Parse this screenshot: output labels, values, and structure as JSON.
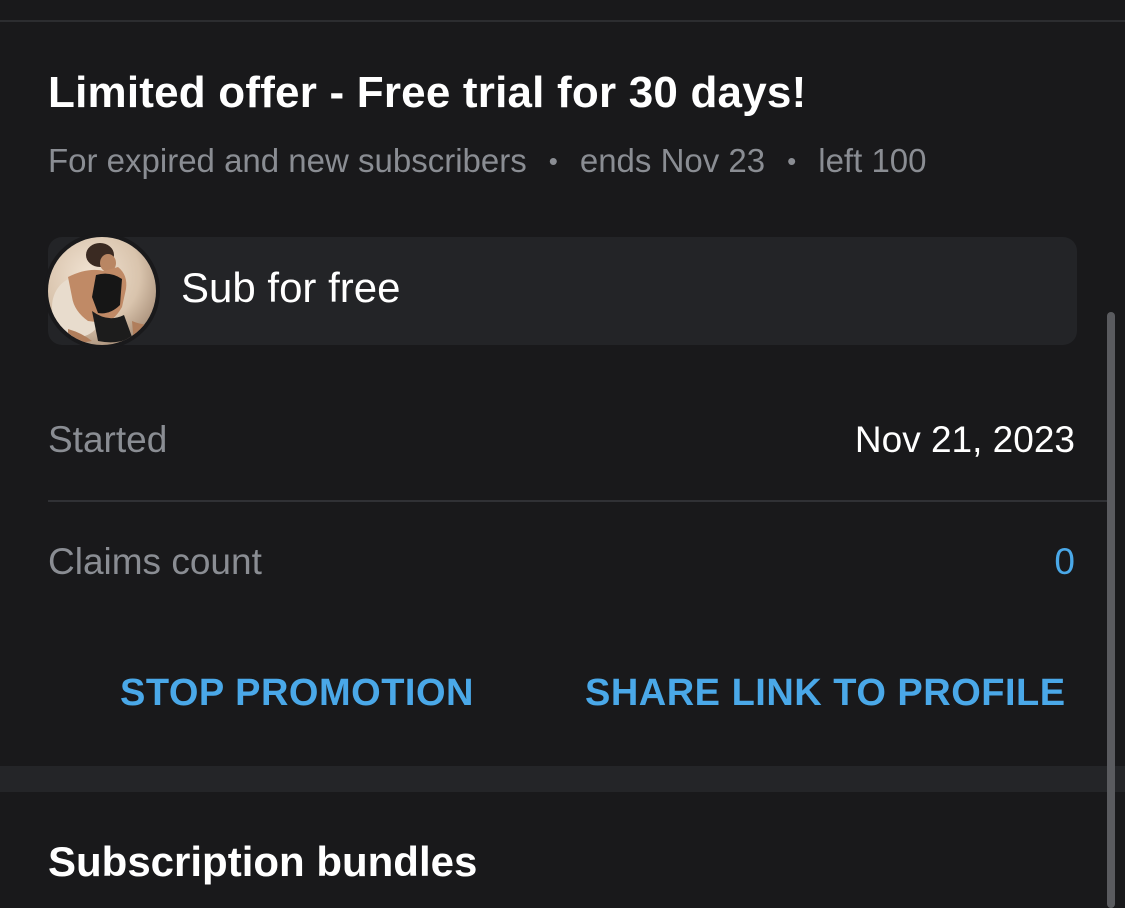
{
  "offer": {
    "title": "Limited offer - Free trial for 30 days!",
    "audience": "For expired and new subscribers",
    "separator": "•",
    "ends": "ends Nov 23",
    "left": "left 100"
  },
  "promo": {
    "message": "Sub for free"
  },
  "details": {
    "started_label": "Started",
    "started_value": "Nov 21, 2023",
    "claims_label": "Claims count",
    "claims_value": "0"
  },
  "actions": {
    "stop_label": "STOP PROMOTION",
    "share_label": "SHARE LINK TO PROFILE"
  },
  "bundles": {
    "title": "Subscription bundles"
  },
  "colors": {
    "background": "#19191b",
    "accent": "#4aa8e8",
    "muted_text": "#8a8d93",
    "card": "#232427"
  }
}
